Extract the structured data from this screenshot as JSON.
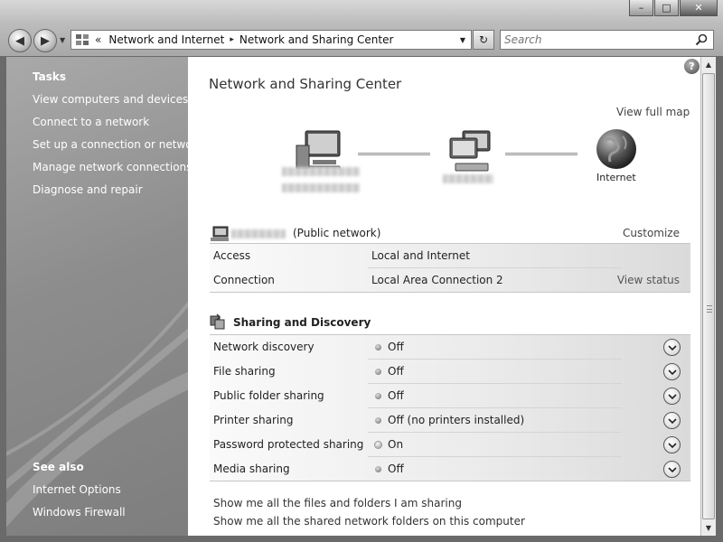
{
  "window": {
    "minimize_glyph": "–",
    "maximize_glyph": "□",
    "close_glyph": "✕"
  },
  "toolbar": {
    "back_glyph": "◀",
    "forward_glyph": "▶",
    "breadcrumb_overflow": "«",
    "breadcrumb": [
      "Network and Internet",
      "Network and Sharing Center"
    ],
    "crumb_separator": "▸",
    "refresh_glyph": "↻",
    "search_placeholder": "Search"
  },
  "sidebar": {
    "tasks_heading": "Tasks",
    "tasks": [
      "View computers and devices",
      "Connect to a network",
      "Set up a connection or network",
      "Manage network connections",
      "Diagnose and repair"
    ],
    "see_also_heading": "See also",
    "see_also": [
      "Internet Options",
      "Windows Firewall"
    ]
  },
  "main": {
    "help_glyph": "?",
    "title": "Network and Sharing Center",
    "view_full_map": "View full map",
    "internet_label": "Internet",
    "network": {
      "type": "(Public network)",
      "customize": "Customize",
      "rows": [
        {
          "label": "Access",
          "value": "Local and Internet"
        },
        {
          "label": "Connection",
          "value": "Local Area Connection 2",
          "action": "View status"
        }
      ]
    },
    "sharing": {
      "heading": "Sharing and Discovery",
      "rows": [
        {
          "label": "Network discovery",
          "value": "Off",
          "on": false
        },
        {
          "label": "File sharing",
          "value": "Off",
          "on": false
        },
        {
          "label": "Public folder sharing",
          "value": "Off",
          "on": false
        },
        {
          "label": "Printer sharing",
          "value": "Off (no printers installed)",
          "on": false
        },
        {
          "label": "Password protected sharing",
          "value": "On",
          "on": true
        },
        {
          "label": "Media sharing",
          "value": "Off",
          "on": false
        }
      ]
    },
    "footer_links": [
      "Show me all the files and folders I am sharing",
      "Show me all the shared network folders on this computer"
    ]
  },
  "scrollbar": {
    "up_glyph": "▲",
    "down_glyph": "▼"
  },
  "colors": {
    "sidebar": "#8d8d8d",
    "chrome": "#bdbdbd",
    "content": "#ffffff"
  }
}
